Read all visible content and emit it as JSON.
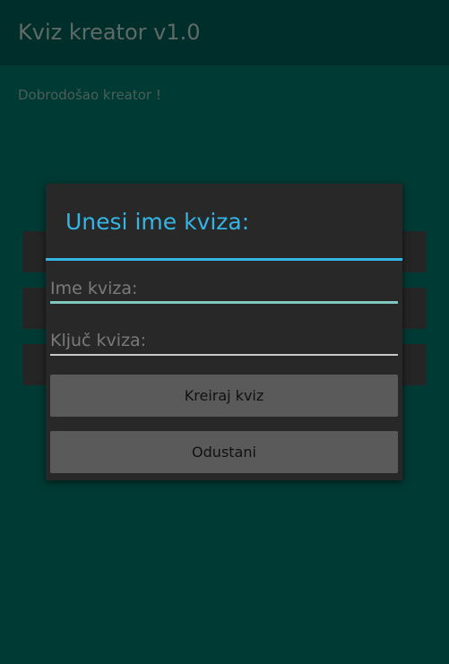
{
  "app": {
    "title": "Kviz kreator v1.0",
    "welcome": "Dobrodošao kreator !"
  },
  "dialog": {
    "title": "Unesi ime kviza:",
    "name_placeholder": "Ime kviza:",
    "key_placeholder": "Ključ kviza:",
    "create_label": "Kreiraj kviz",
    "cancel_label": "Odustani"
  },
  "colors": {
    "accent": "#33b5e5",
    "background": "#003a34",
    "actionbar": "#002f2b"
  }
}
